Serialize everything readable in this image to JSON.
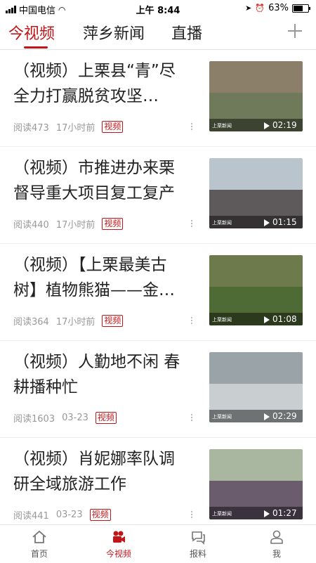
{
  "status_bar": {
    "carrier": "中国电信",
    "time": "上午 8:44",
    "battery": "63%"
  },
  "tabs": [
    {
      "label": "今视频",
      "active": true
    },
    {
      "label": "萍乡新闻",
      "active": false
    },
    {
      "label": "直播",
      "active": false
    }
  ],
  "items": [
    {
      "title": "（视频）上栗县“青”尽全力打赢脱贫攻坚…",
      "reads": "阅读473",
      "time": "17小时前",
      "badge": "视频",
      "duration": "02:19",
      "channel": "上栗新闻"
    },
    {
      "title": "（视频）市推进办来栗督导重大项目复工复产",
      "reads": "阅读440",
      "time": "17小时前",
      "badge": "视频",
      "duration": "01:15",
      "channel": "上栗新闻"
    },
    {
      "title": "（视频）【上栗最美古树】植物熊猫——金…",
      "reads": "阅读364",
      "time": "17小时前",
      "badge": "视频",
      "duration": "01:08",
      "channel": "上栗新闻"
    },
    {
      "title": "（视频）人勤地不闲 春耕播种忙",
      "reads": "阅读1603",
      "time": "03-23",
      "badge": "视频",
      "duration": "02:29",
      "channel": "上栗新闻"
    },
    {
      "title": "（视频）肖妮娜率队调研全域旅游工作",
      "reads": "阅读441",
      "time": "03-23",
      "badge": "视频",
      "duration": "01:27",
      "channel": "上栗新闻"
    }
  ],
  "bottom_nav": [
    {
      "label": "首页",
      "icon": "home-icon",
      "active": false
    },
    {
      "label": "今视频",
      "icon": "camera-icon",
      "active": true
    },
    {
      "label": "报料",
      "icon": "chat-icon",
      "active": false
    },
    {
      "label": "我",
      "icon": "user-icon",
      "active": false
    }
  ],
  "colors": {
    "accent": "#c0161a"
  }
}
